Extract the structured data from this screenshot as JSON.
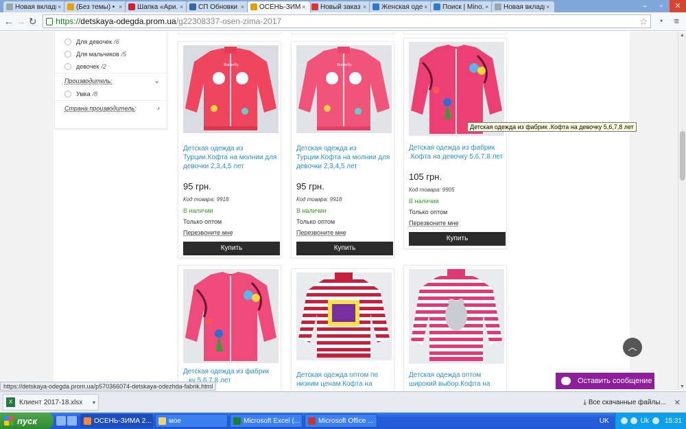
{
  "browser": {
    "tabs": [
      {
        "title": "Новая вкладка",
        "fav_color": "#9aa",
        "active": false
      },
      {
        "title": "(Без темы) • ...",
        "fav_color": "#e3a300",
        "active": false
      },
      {
        "title": "Шапка «Ари...",
        "fav_color": "#c23",
        "active": false
      },
      {
        "title": "СП Обновки ...",
        "fav_color": "#36a",
        "active": false
      },
      {
        "title": "ОСЕНЬ-ЗИМА ...",
        "fav_color": "#d9a400",
        "active": true
      },
      {
        "title": "Новый заказ ...",
        "fav_color": "#d33",
        "active": false
      },
      {
        "title": "Женская оде...",
        "fav_color": "#37c",
        "active": false
      },
      {
        "title": "Поиск | Mino...",
        "fav_color": "#37c",
        "active": false
      },
      {
        "title": "Новая вкладка",
        "fav_color": "#9aa",
        "active": false
      }
    ],
    "url_scheme": "https://",
    "url_host": "detskaya-odegda.prom.ua",
    "url_path": "/g22308337-osen-zima-2017",
    "status_url": "https://detskaya-odegda.prom.ua/p570366074-detskaya-odezhda-fabrik.html"
  },
  "sidebar": {
    "gender_filters": [
      {
        "label": "Для девочек",
        "count": "/6"
      },
      {
        "label": "Для мальчиков",
        "count": "/5"
      },
      {
        "label": "девочек",
        "count": "/2"
      }
    ],
    "manufacturer_heading": "Производитель:",
    "manufacturer_filters": [
      {
        "label": "Умка",
        "count": "/8"
      }
    ],
    "country_heading": "Страна производитель:"
  },
  "products": [
    {
      "name": "Детская одежда из Турции.Кофта на молнии для девочки 2,3,4,5 лет",
      "price": "95 грн.",
      "code": "Код товара: 9918",
      "stock": "В наличии",
      "wholesale": "Только оптом",
      "callback": "Перезвоните мне",
      "buy": "Купить"
    },
    {
      "name": "Детская одежда из Турции.Кофта на молнии для девочки 2,3,4,5 лет",
      "price": "95 грн.",
      "code": "Код товара: 9918",
      "stock": "В наличии",
      "wholesale": "Только оптом",
      "callback": "Перезвоните мне",
      "buy": "Купить"
    },
    {
      "name": "Детская одежда из фабрик .Кофта на девочку 5,6,7,8 лет",
      "price": "105 грн.",
      "code": "Код товара: 9905",
      "stock": "В наличии",
      "wholesale": "Только оптом",
      "callback": "Перезвоните мне",
      "buy": "Купить"
    },
    {
      "name": "Детская одежда из фабрик ...ку 5,6,7,8 лет"
    },
    {
      "name": "Детская одежда оптом по низким ценам.Кофта на"
    },
    {
      "name": "Детская одежда оптом широкий выбор.Кофта на"
    }
  ],
  "tooltip": "Детская одежда из фабрик .Кофта на девочку 5,6,7,8 лет",
  "chat_button": "Оставить сообщение",
  "downloads": {
    "file": "Клиент 2017-18.xlsx",
    "show_all": "Все скачанные файлы..."
  },
  "taskbar": {
    "start": "пуск",
    "tasks": [
      {
        "title": "ОСЕНЬ-ЗИМА 2...",
        "icon_color": "#e84",
        "active": true
      },
      {
        "title": "мое",
        "icon_color": "#f5d36b",
        "active": false
      },
      {
        "title": "Microsoft Excel (...",
        "icon_color": "#1e7b3d",
        "active": false
      },
      {
        "title": "Microsoft Office ...",
        "icon_color": "#c33",
        "active": false
      }
    ],
    "lang": "UK",
    "tray_lang": "Uk",
    "clock": "15:31"
  }
}
